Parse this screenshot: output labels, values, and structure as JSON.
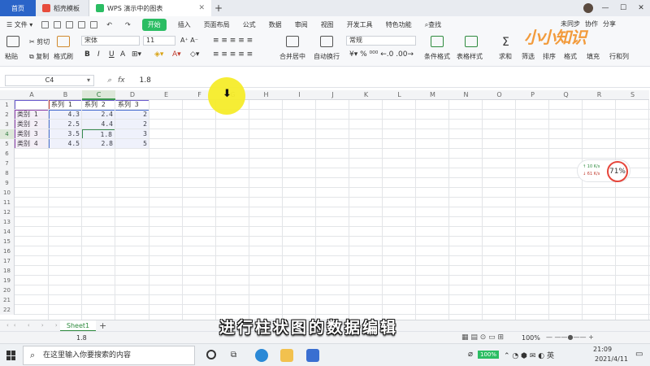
{
  "tabs": {
    "home": "首页",
    "tab1": "稻壳模板",
    "tab2": "WPS 演示中的图表"
  },
  "menu": {
    "file": "文件",
    "items": [
      "开始",
      "插入",
      "页面布局",
      "公式",
      "数据",
      "审阅",
      "视图",
      "开发工具",
      "特色功能"
    ],
    "search": "查找",
    "sync": "未同步",
    "collab": "协作",
    "share": "分享"
  },
  "ribbon": {
    "paste": "粘贴",
    "cut": "剪切",
    "copy": "复制",
    "format_painter": "格式刷",
    "font_name": "宋体",
    "font_size": "11",
    "merge_center": "合并居中",
    "wrap_text": "自动换行",
    "number_format": "常规",
    "cond_format": "条件格式",
    "table_style": "表格样式",
    "sum": "求和",
    "filter": "筛选",
    "sort": "排序",
    "format": "格式",
    "fill": "填充",
    "rows_cols": "行和列"
  },
  "formula_bar": {
    "name_box": "C4",
    "value": "1.8"
  },
  "columns": [
    "A",
    "B",
    "C",
    "D",
    "E",
    "F",
    "G",
    "H",
    "I",
    "J",
    "K",
    "L",
    "M",
    "N",
    "O",
    "P",
    "Q",
    "R",
    "S"
  ],
  "rows": [
    "1",
    "2",
    "3",
    "4",
    "5",
    "6",
    "7",
    "8",
    "9",
    "10",
    "11",
    "12",
    "13",
    "14",
    "15",
    "16",
    "17",
    "18",
    "19",
    "20",
    "21",
    "22"
  ],
  "sheet_data": {
    "headers": [
      "系列 1",
      "系列 2",
      "系列 3"
    ],
    "rows": [
      {
        "label": "类别 1",
        "v1": "4.3",
        "v2": "2.4",
        "v3": "2"
      },
      {
        "label": "类别 2",
        "v1": "2.5",
        "v2": "4.4",
        "v3": "2"
      },
      {
        "label": "类别 3",
        "v1": "3.5",
        "v2": "1.8",
        "v3": "3"
      },
      {
        "label": "类别 4",
        "v1": "4.5",
        "v2": "2.8",
        "v3": "5"
      }
    ]
  },
  "net_widget": {
    "up": "10 K/s",
    "down": "61 K/s",
    "percent": "71%"
  },
  "sheet_tab": "Sheet1",
  "status": {
    "value": "1.8",
    "zoom": "100%"
  },
  "subtitle": "进行柱状图的数据编辑",
  "taskbar": {
    "search_placeholder": "在这里输入你要搜索的内容",
    "battery": "100%",
    "time": "21:09",
    "date": "2021/4/11"
  },
  "watermark": "小小知识"
}
